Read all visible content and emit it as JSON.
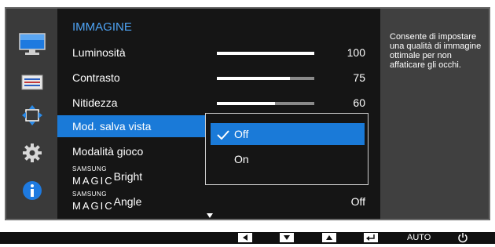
{
  "menu": {
    "title": "IMMAGINE",
    "rows": [
      {
        "label": "Luminosità",
        "value": "100",
        "level": 1.0
      },
      {
        "label": "Contrasto",
        "value": "75",
        "level": 0.75
      },
      {
        "label": "Nitidezza",
        "value": "60",
        "level": 0.6
      },
      {
        "label": "Mod. salva vista"
      },
      {
        "label": "Modalità gioco"
      },
      {
        "magic_top": "SAMSUNG",
        "magic_word": "MAGIC",
        "label": "Bright"
      },
      {
        "magic_top": "SAMSUNG",
        "magic_word": "MAGIC",
        "label": "Angle",
        "value": "Off"
      }
    ]
  },
  "popup": {
    "options": [
      {
        "label": "Off",
        "selected": true
      },
      {
        "label": "On",
        "selected": false
      }
    ]
  },
  "description": "Consente di impostare una qualità di immagine ottimale per non affaticare gli occhi.",
  "bottom_bar": {
    "auto_label": "AUTO"
  },
  "colors": {
    "accent": "#1a7ad8",
    "title": "#4ea4f5"
  },
  "icons": [
    "monitor-icon",
    "picture-settings-icon",
    "position-arrows-icon",
    "gear-icon",
    "info-icon"
  ]
}
